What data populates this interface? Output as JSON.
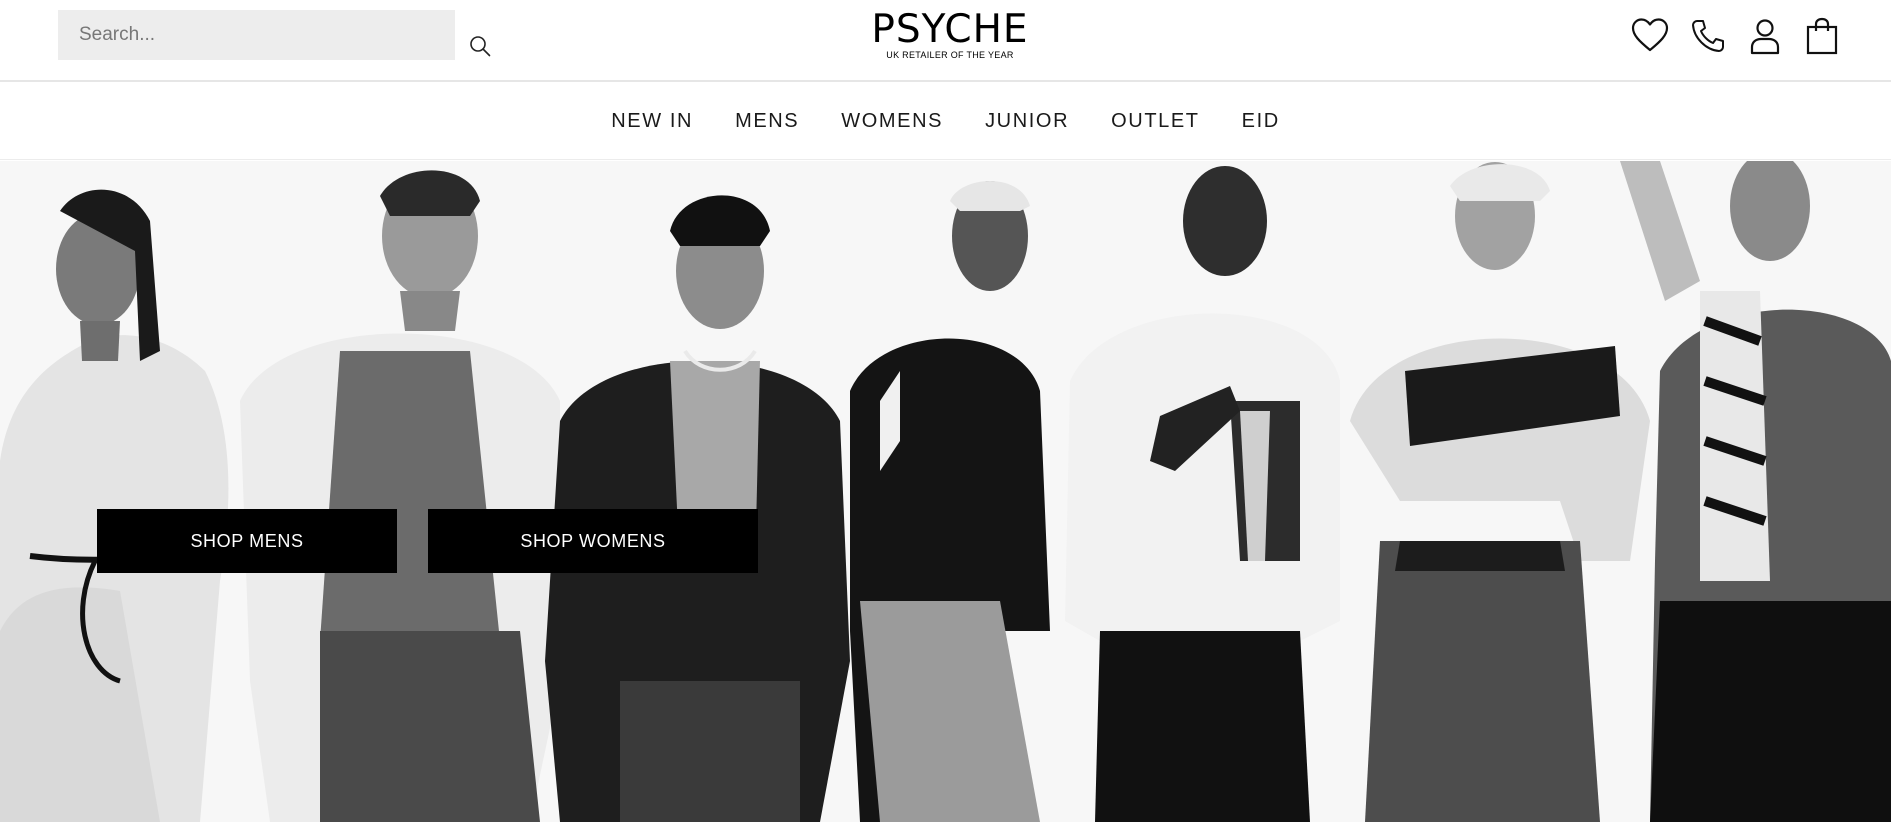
{
  "header": {
    "search": {
      "placeholder": "Search..."
    },
    "logo": {
      "wordmark": "PSYCHE",
      "tagline": "UK RETAILER OF THE YEAR"
    },
    "icons": [
      "heart-icon",
      "phone-icon",
      "user-icon",
      "bag-icon"
    ]
  },
  "nav": {
    "items": [
      {
        "label": "NEW IN"
      },
      {
        "label": "MENS"
      },
      {
        "label": "WOMENS"
      },
      {
        "label": "JUNIOR"
      },
      {
        "label": "OUTLET"
      },
      {
        "label": "EID"
      }
    ]
  },
  "hero": {
    "image": "campaign-models-photo",
    "buttons": {
      "shop_mens": "SHOP MENS",
      "shop_womens": "SHOP WOMENS"
    }
  },
  "colors": {
    "text": "#1a1a1a",
    "search_bg": "#ededed",
    "button_bg": "#000000",
    "button_text": "#ffffff"
  }
}
